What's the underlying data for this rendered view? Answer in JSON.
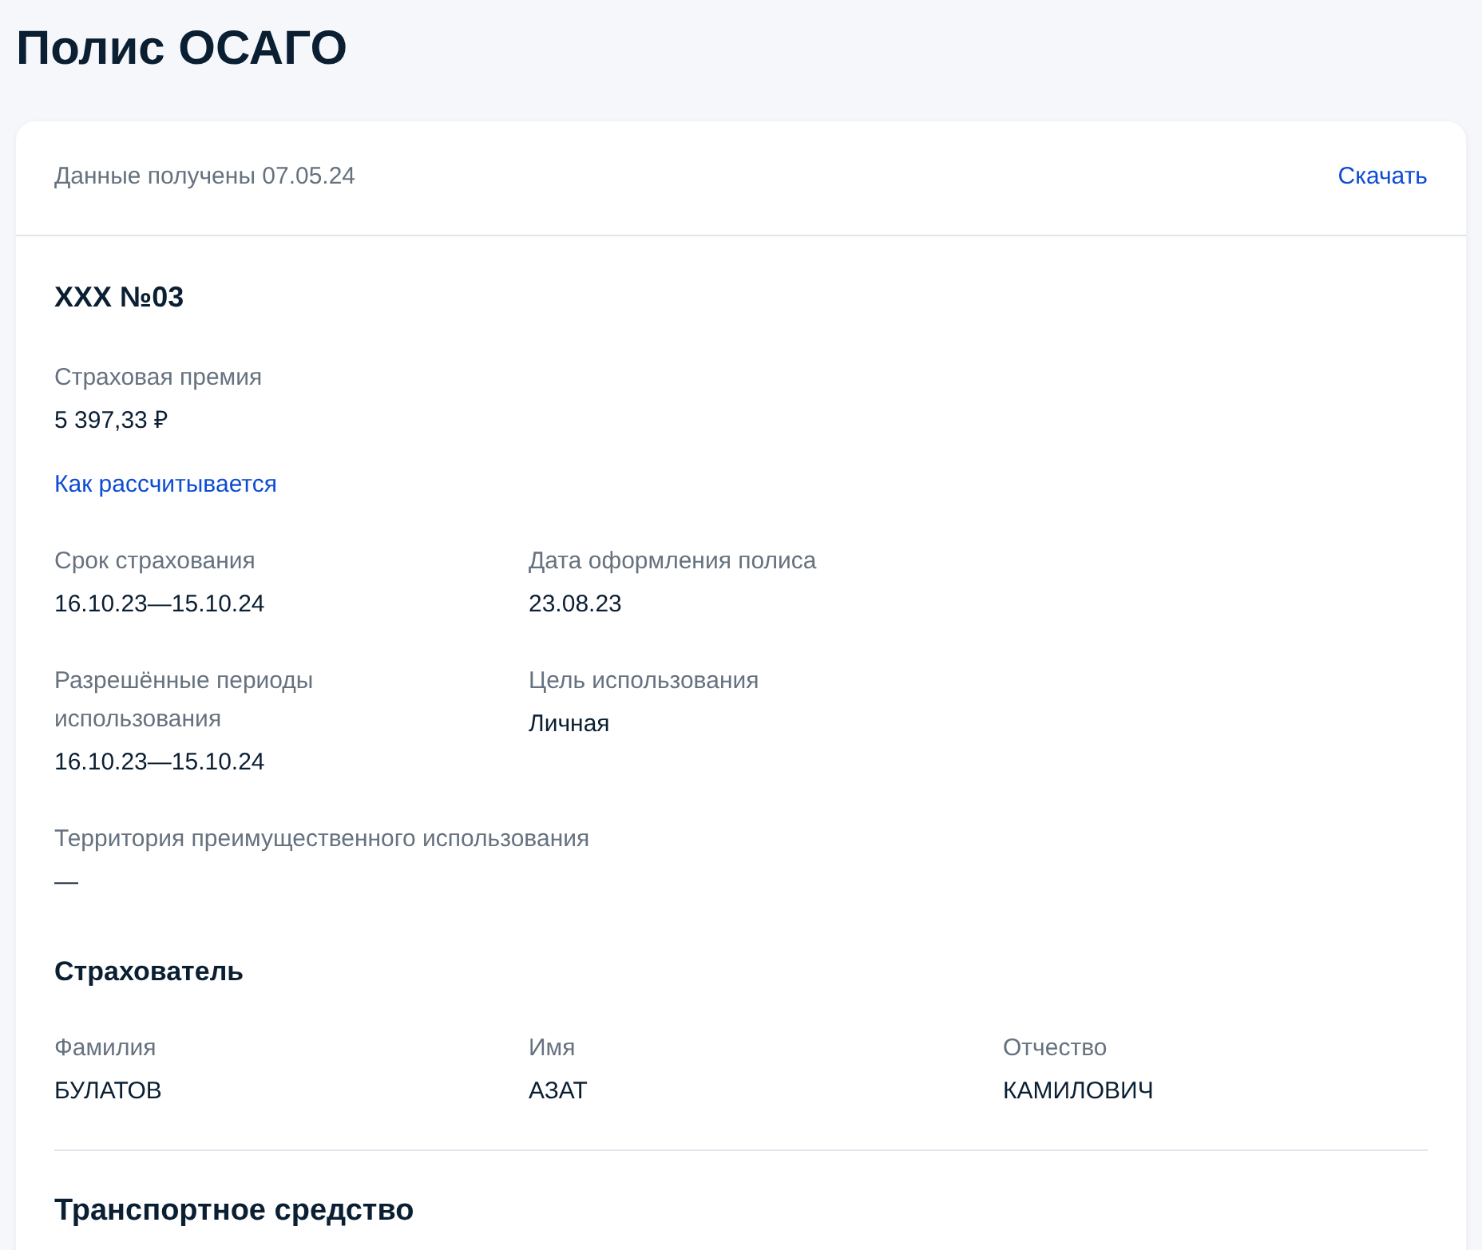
{
  "page_title": "Полис ОСАГО",
  "card": {
    "received": "Данные получены 07.05.24",
    "download": "Скачать"
  },
  "policy": {
    "number": "XXX №03",
    "premium": {
      "label": "Страховая премия",
      "value": "5 397,33 ₽"
    },
    "calc_link": "Как рассчитывается",
    "fields": [
      {
        "label": "Срок страхования",
        "value": "16.10.23—15.10.24"
      },
      {
        "label": "Дата оформления полиса",
        "value": "23.08.23"
      },
      {
        "label": "Разрешённые периоды использования",
        "value": "16.10.23—15.10.24"
      },
      {
        "label": "Цель использования",
        "value": "Личная"
      }
    ],
    "territory": {
      "label": "Территория преимущественного использования",
      "value": "—"
    }
  },
  "insurer": {
    "title": "Страхователь",
    "fields": [
      {
        "label": "Фамилия",
        "value": "БУЛАТОВ"
      },
      {
        "label": "Имя",
        "value": "АЗАТ"
      },
      {
        "label": "Отчество",
        "value": "КАМИЛОВИЧ"
      }
    ]
  },
  "vehicle": {
    "title": "Транспортное средство"
  }
}
